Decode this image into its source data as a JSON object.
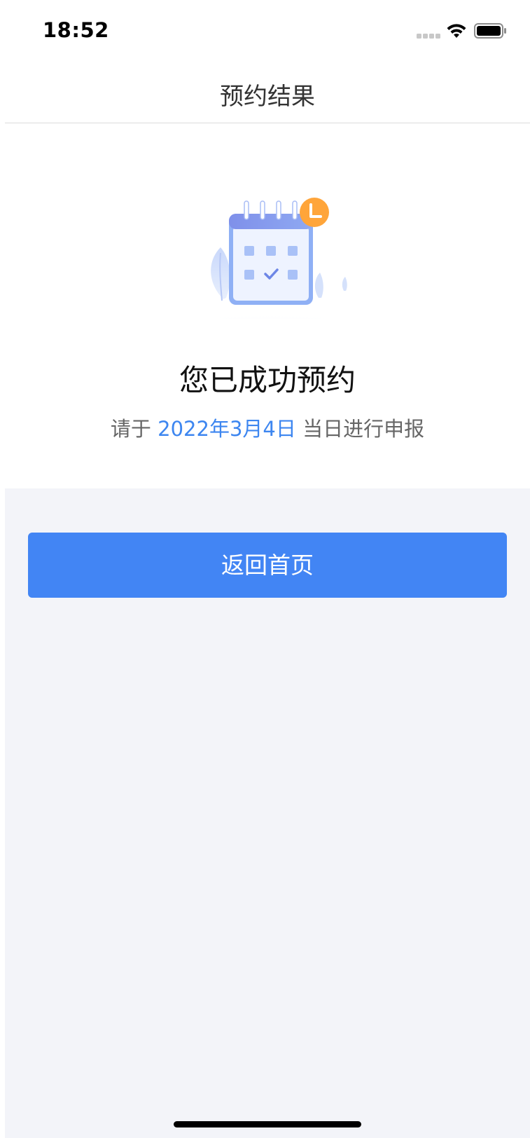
{
  "status_bar": {
    "time": "18:52"
  },
  "nav": {
    "title": "预约结果"
  },
  "result": {
    "title": "您已成功预约",
    "subtitle_prefix": "请于 ",
    "date": "2022年3月4日",
    "subtitle_suffix": " 当日进行申报"
  },
  "actions": {
    "home_button_label": "返回首页"
  },
  "colors": {
    "accent": "#4285f4",
    "date_text": "#3d86f0",
    "background_gray": "#f3f4f9",
    "clock_badge": "#ffa53a"
  },
  "icons": {
    "illustration": "calendar-check-clock-illustration"
  }
}
